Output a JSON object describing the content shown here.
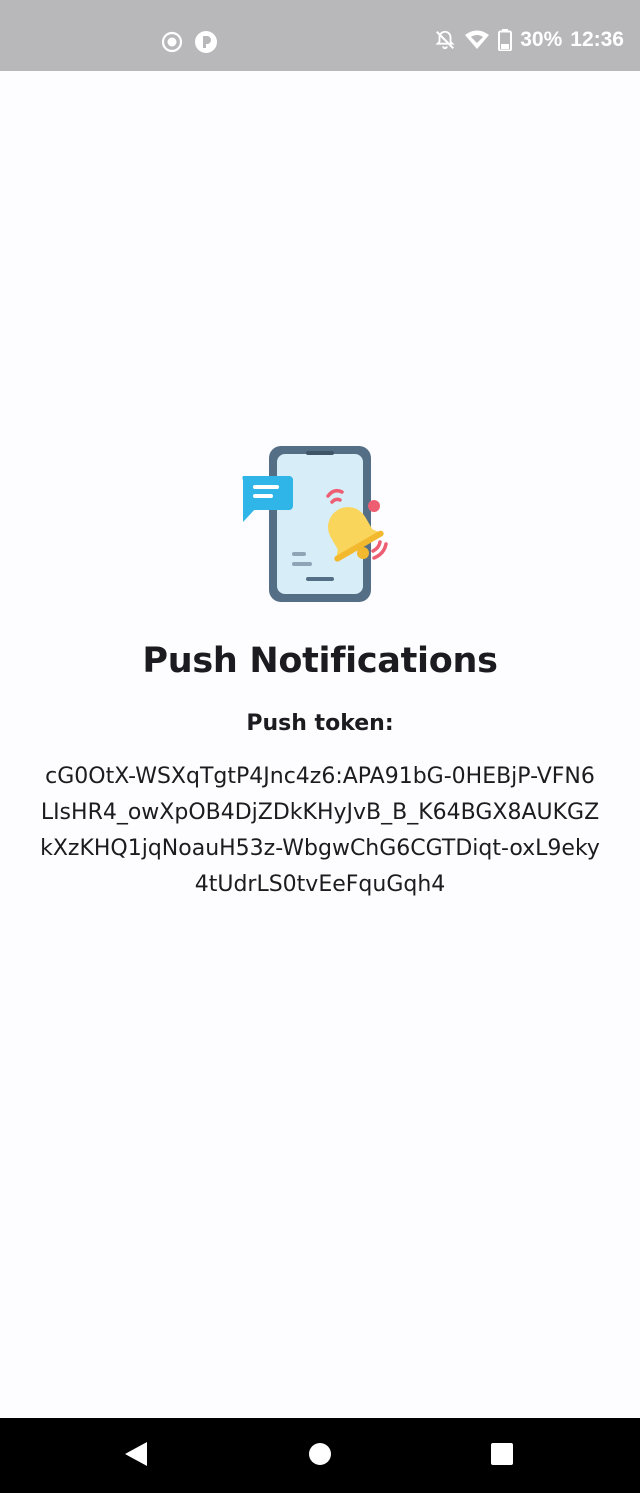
{
  "status_bar": {
    "battery": "30%",
    "time": "12:36",
    "icons": [
      "screen-record-icon",
      "app-notification-icon",
      "notifications-off-icon",
      "wifi-icon",
      "battery-icon"
    ]
  },
  "main": {
    "illustration": "phone-notification-bell-icon",
    "title": "Push Notifications",
    "token_label": "Push token:",
    "token_value": "cG0OtX-WSXqTgtP4Jnc4z6:APA91bG-0HEBjP-VFN6LIsHR4_owXpOB4DjZDkKHyJvB_B_K64BGX8AUKGZkXzKHQ1jqNoauH53z-WbgwChG6CGTDiqt-oxL9eky4tUdrLS0tvEeFquGqh4"
  },
  "navigation": {
    "buttons": [
      "back-icon",
      "home-icon",
      "recents-icon"
    ]
  },
  "colors": {
    "status_bar": "#b8b7ba",
    "background": "#fdfcff",
    "text": "#1c1b1f",
    "nav_bar": "#000000"
  }
}
